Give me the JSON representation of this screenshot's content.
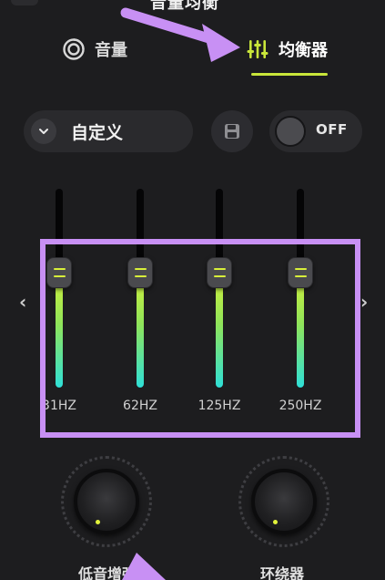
{
  "header": {
    "title": "音量均衡"
  },
  "tabs": [
    {
      "label": "音量",
      "icon": "volume-ring-icon",
      "active": false
    },
    {
      "label": "均衡器",
      "icon": "equalizer-sliders-icon",
      "active": true
    }
  ],
  "preset": {
    "label": "自定义",
    "icon": "chevron-down-icon"
  },
  "save_button": {
    "icon": "floppy-disk-icon"
  },
  "toggle": {
    "label": "OFF",
    "state": false
  },
  "equalizer": {
    "bands": [
      {
        "label": "31HZ",
        "level": 0.58
      },
      {
        "label": "62HZ",
        "level": 0.58
      },
      {
        "label": "125HZ",
        "level": 0.58
      },
      {
        "label": "250HZ",
        "level": 0.58
      }
    ],
    "prev_icon": "chevron-left-icon",
    "next_icon": "chevron-right-icon"
  },
  "knobs": [
    {
      "label": "低音增强"
    },
    {
      "label": "环绕器"
    }
  ],
  "colors": {
    "accent": "#c9e63a",
    "slider_fill_top": "#d4f03a",
    "slider_fill_bottom": "#2fe0d8",
    "annotation": "#c890f4",
    "background": "#1d1d1f"
  }
}
